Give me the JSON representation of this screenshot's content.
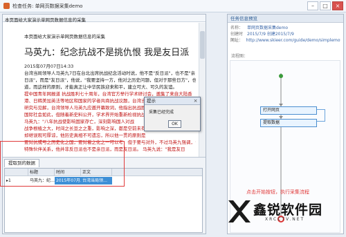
{
  "window": {
    "title": "检查任务: 单网页数据采集demo",
    "min": "–",
    "max": "□",
    "close": "×"
  },
  "document": {
    "tab_title": "本页面给大家演示单网页数据信息的采集",
    "intro": "本页面给大家演示单网页数据信息的采集",
    "headline": "马英九：纪念抗战不是挑仇恨 我是友日派",
    "date": "2015年07月07日14:33",
    "lines": [
      "台湾当局领导人马英九7日在台北出席抗战纪念活动时说，他不是\"反日派\"，也不是\"亲",
      "日派\"，而是\"友日派\"，他说，\"我要坚持一方，他对之历史问题，但对于那些日方\"，也",
      "道，而这样的原则，才能真正让中华民族迎来和平，建立可大、可久的友谊。",
      "提中国青年网报道 抗战胜利七十周年，台湾官方举行学术研讨会，邀集了来自大陆香",
      "港、日韩美加英法等地区和国家的学者共商抗战议题，台湾当局领导人马英九出席",
      "研究与见解，台湾领导人马英九应邀开幕致词，他指出抗战胜",
      "国际社会如此，但随着新史料公开，学术界开始重新检视抗战",
      "        马英九：\"八年抗战使影响国家存亡，深刻影响国人对战",
      "战争根植之大，时间之长亘之之重，影响之深，都是空前未有",
      "却继误观可厚谅，他历史真相不可遗忘，所以他一贯的原则是",
      "要对抗或与之历史化之国，要对着之化之一可以考，但于要与对外，不过马英九强调，台日关系是",
      "特殊伙伴关系，他并非反日派也不是亲日派，而是友日派。     马英九说：\"我是友日"
    ]
  },
  "dialog": {
    "title": "提示",
    "close": "×",
    "message": "采集已经完成",
    "ok_label": "OK"
  },
  "results_panel": {
    "tab_label": "提取到的数据",
    "columns": [
      "",
      "标题",
      "时间",
      "正文"
    ],
    "rows": [
      {
        "marker": "▸1",
        "title": "马英九：纪…",
        "time": "2015年07月…",
        "body": "台湾当局领…"
      }
    ]
  },
  "task_panel": {
    "header": "任务信息预览",
    "fields": [
      {
        "label": "名称：",
        "value": "单网页数据采集demo"
      },
      {
        "label": "创建时间：",
        "value": "2015/7/9 创建2015/7/9"
      },
      {
        "label": "网址：",
        "value": "http://www.skieer.com/guide/demo/simplemov..."
      }
    ],
    "flow_label": "流程图：",
    "flow_nodes": [
      "打开网页",
      "提取数据"
    ]
  },
  "annotation": "点击开始按钮，执行采集流程",
  "watermark": {
    "name": "鑫锐软件园",
    "url": "XRCCTV.NET"
  },
  "colors": {
    "accent": "#3d8fd6",
    "annotation_red": "#e03a3a",
    "flow_blue": "#4a8ed0"
  }
}
